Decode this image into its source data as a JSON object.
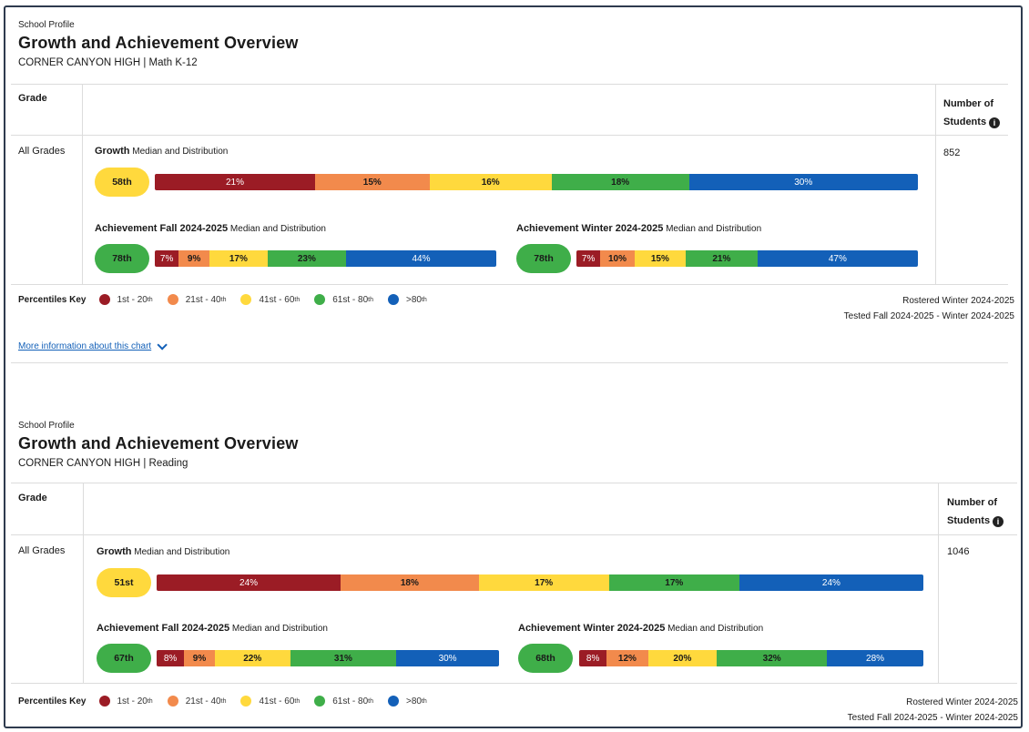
{
  "colors": {
    "p1": "#9b1c25",
    "p2": "#f28a4c",
    "p3": "#ffd93d",
    "p4": "#3fae49",
    "p5": "#1360b8"
  },
  "sections": [
    {
      "kicker": "School Profile",
      "title": "Growth and Achievement Overview",
      "subtitle": "CORNER CANYON HIGH | Math K-12",
      "grade_header": "Grade",
      "students_header_1": "Number of",
      "students_header_2": "Students",
      "row_label": "All Grades",
      "student_count": "852",
      "growth": {
        "title": "Growth",
        "sub": "Median and Distribution",
        "median": "58th",
        "segments": [
          {
            "label": "21%",
            "value": 21
          },
          {
            "label": "15%",
            "value": 15
          },
          {
            "label": "16%",
            "value": 16
          },
          {
            "label": "18%",
            "value": 18
          },
          {
            "label": "30%",
            "value": 30
          }
        ]
      },
      "fall": {
        "title": "Achievement Fall 2024-2025",
        "sub": "Median and Distribution",
        "median": "78th",
        "segments": [
          {
            "label": "7%",
            "value": 7
          },
          {
            "label": "9%",
            "value": 9
          },
          {
            "label": "17%",
            "value": 17
          },
          {
            "label": "23%",
            "value": 23
          },
          {
            "label": "44%",
            "value": 44
          }
        ]
      },
      "winter": {
        "title": "Achievement Winter 2024-2025",
        "sub": "Median and Distribution",
        "median": "78th",
        "segments": [
          {
            "label": "7%",
            "value": 7
          },
          {
            "label": "10%",
            "value": 10
          },
          {
            "label": "15%",
            "value": 15
          },
          {
            "label": "21%",
            "value": 21
          },
          {
            "label": "47%",
            "value": 47
          }
        ]
      },
      "key_title": "Percentiles Key",
      "rostered": "Rostered Winter 2024-2025",
      "tested": "Tested Fall 2024-2025 - Winter 2024-2025",
      "more_info": "More information about this chart"
    },
    {
      "kicker": "School Profile",
      "title": "Growth and Achievement Overview",
      "subtitle": "CORNER CANYON HIGH | Reading",
      "grade_header": "Grade",
      "students_header_1": "Number of",
      "students_header_2": "Students",
      "row_label": "All Grades",
      "student_count": "1046",
      "growth": {
        "title": "Growth",
        "sub": "Median and Distribution",
        "median": "51st",
        "segments": [
          {
            "label": "24%",
            "value": 24
          },
          {
            "label": "18%",
            "value": 18
          },
          {
            "label": "17%",
            "value": 17
          },
          {
            "label": "17%",
            "value": 17
          },
          {
            "label": "24%",
            "value": 24
          }
        ]
      },
      "fall": {
        "title": "Achievement Fall 2024-2025",
        "sub": "Median and Distribution",
        "median": "67th",
        "segments": [
          {
            "label": "8%",
            "value": 8
          },
          {
            "label": "9%",
            "value": 9
          },
          {
            "label": "22%",
            "value": 22
          },
          {
            "label": "31%",
            "value": 31
          },
          {
            "label": "30%",
            "value": 30
          }
        ]
      },
      "winter": {
        "title": "Achievement Winter 2024-2025",
        "sub": "Median and Distribution",
        "median": "68th",
        "segments": [
          {
            "label": "8%",
            "value": 8
          },
          {
            "label": "12%",
            "value": 12
          },
          {
            "label": "20%",
            "value": 20
          },
          {
            "label": "32%",
            "value": 32
          },
          {
            "label": "28%",
            "value": 28
          }
        ]
      },
      "key_title": "Percentiles Key",
      "rostered": "Rostered Winter 2024-2025",
      "tested": "Tested Fall 2024-2025 - Winter 2024-2025"
    }
  ],
  "key": [
    {
      "a": "1st - 20",
      "sup": "th"
    },
    {
      "a": "21st - 40",
      "sup": "th"
    },
    {
      "a": "41st - 60",
      "sup": "th"
    },
    {
      "a": "61st - 80",
      "sup": "th"
    },
    {
      "a": ">80",
      "sup": "th"
    }
  ]
}
